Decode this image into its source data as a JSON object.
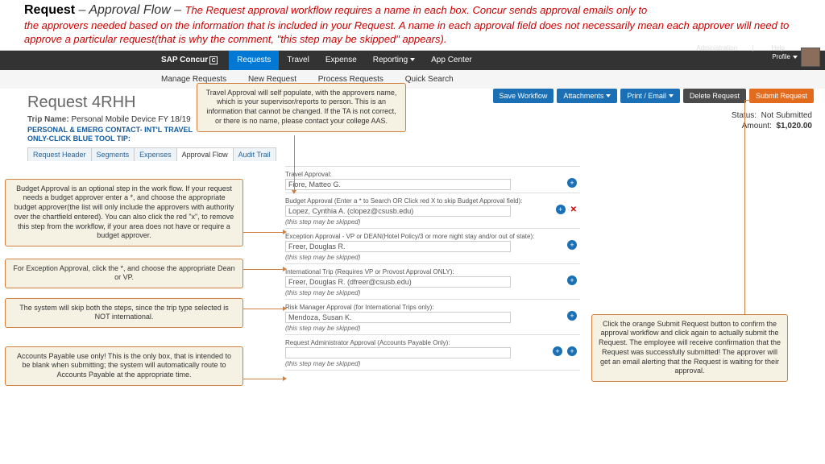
{
  "doc": {
    "title_bold": "Request",
    "title_sep": " – ",
    "title_italic": "Approval Flow – ",
    "title_red_inline": "The Request approval workflow requires a name in each box. Concur sends approval emails only to",
    "title_red_line2": "the approvers needed based on the information that is included in your Request. A name in each approval field does not necessarily mean each approver will need to approve a particular request(that is why the comment, \"this step may be skipped\" appears)."
  },
  "topbar": {
    "brand": "SAP Concur",
    "nav": [
      "Requests",
      "Travel",
      "Expense",
      "Reporting",
      "App Center"
    ],
    "admin": "Administration",
    "help": "Help",
    "profile": "Profile"
  },
  "subnav": [
    "Manage Requests",
    "New Request",
    "Process Requests",
    "Quick Search"
  ],
  "page": {
    "title": "Request 4RHH",
    "trip_label": "Trip Name:",
    "trip_value": "Personal Mobile Device FY 18/19",
    "tip": "PERSONAL & EMERG CONTACT- INT'L TRAVEL ONLY-CLICK BLUE TOOL TIP:",
    "tabs": [
      "Request Header",
      "Segments",
      "Expenses",
      "Approval Flow",
      "Audit Trail"
    ]
  },
  "buttons": {
    "save": "Save Workflow",
    "attach": "Attachments",
    "print": "Print / Email",
    "delete": "Delete Request",
    "submit": "Submit Request"
  },
  "status": {
    "status_label": "Status:",
    "status_value": "Not Submitted",
    "amount_label": "Amount:",
    "amount_value": "$1,020.00"
  },
  "workflow": [
    {
      "label": "Travel Approval:",
      "value": "Fiore, Matteo G.",
      "plus": true,
      "x": false,
      "skip": false
    },
    {
      "label": "Budget Approval (Enter a * to Search OR Click red X to skip Budget Approval field):",
      "value": "Lopez, Cynthia A. (clopez@csusb.edu)",
      "plus": true,
      "x": true,
      "skip": true
    },
    {
      "label": "Exception Approval - VP or DEAN(Hotel Policy/3 or more night stay and/or out of state):",
      "value": "Freer, Douglas R.",
      "plus": true,
      "x": false,
      "skip": true
    },
    {
      "label": "International Trip (Requires VP or Provost Approval ONLY):",
      "value": "Freer, Douglas R. (dfreer@csusb.edu)",
      "plus": true,
      "x": false,
      "skip": true
    },
    {
      "label": "Risk Manager Approval (for International Trips only):",
      "value": "Mendoza, Susan K.",
      "plus": true,
      "x": false,
      "skip": true
    },
    {
      "label": "Request Administrator Approval (Accounts Payable Only):",
      "value": "",
      "plus": true,
      "plus2": true,
      "x": false,
      "skip": true
    }
  ],
  "skip_text": "(this step may be skipped)",
  "callouts": {
    "c1": "Travel Approval will self populate, with the approvers name, which is your supervisor/reports to person. This is an information that cannot be changed. If the TA is not correct, or there is no name, please contact your college AAS.",
    "c2": "Budget Approval is an optional step in the work flow. If your request needs a budget approver enter a *, and choose the appropriate budget approver(the list will only include the approvers with authority over the chartfield entered). You can also click the red \"x\", to remove this step from the workflow, if your area does not have or require a budget approver.",
    "c3": "For Exception Approval, click the *, and choose the appropriate Dean or VP.",
    "c4": "The system will skip both the steps, since the trip type selected is NOT international.",
    "c5": "Accounts Payable use only! This is the only box, that is intended to be blank when submitting; the system will automatically route to Accounts Payable at the appropriate time.",
    "c6": "Click the orange Submit Request button to confirm the approval workflow and click again to actually submit the Request. The employee will receive confirmation that the Request was successfully submitted! The approver will get an email alerting that the Request is waiting for their approval."
  }
}
